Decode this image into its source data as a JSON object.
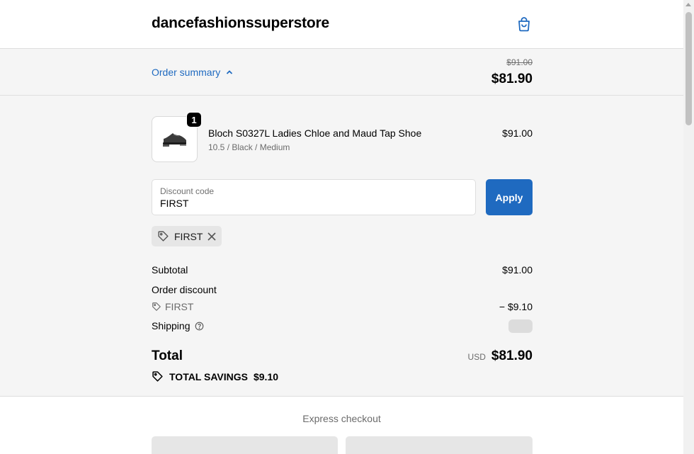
{
  "header": {
    "store_name": "dancefashionssuperstore",
    "cart_icon": "shopping-bag-icon"
  },
  "summary_bar": {
    "toggle_label": "Order summary",
    "toggle_icon": "chevron-up-icon",
    "original_total": "$91.00",
    "discounted_total": "$81.90"
  },
  "product": {
    "quantity": "1",
    "name": "Bloch S0327L Ladies Chloe and Maud Tap Shoe",
    "variant": "10.5 / Black / Medium",
    "price": "$91.00",
    "image_icon": "tap-shoe-image"
  },
  "discount": {
    "label": "Discount code",
    "value": "FIRST",
    "apply_label": "Apply",
    "applied_code": "FIRST"
  },
  "totals": {
    "subtotal_label": "Subtotal",
    "subtotal_value": "$91.00",
    "order_discount_label": "Order discount",
    "discount_code": "FIRST",
    "discount_value": "− $9.10",
    "shipping_label": "Shipping",
    "total_label": "Total",
    "currency": "USD",
    "total_value": "$81.90",
    "savings_label": "TOTAL SAVINGS",
    "savings_value": "$9.10"
  },
  "express": {
    "title": "Express checkout"
  },
  "colors": {
    "accent": "#1f6ac0",
    "summary_bg": "#f5f5f5"
  }
}
